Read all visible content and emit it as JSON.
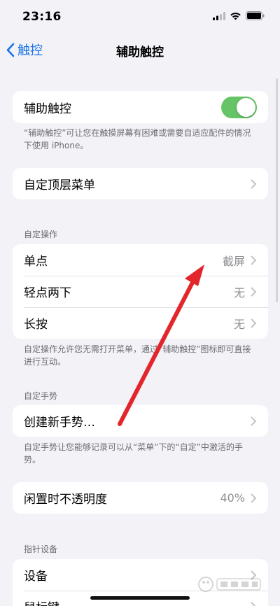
{
  "status": {
    "time": "23:16"
  },
  "nav": {
    "back_label": "触控",
    "title": "辅助触控"
  },
  "main_toggle": {
    "label": "辅助触控",
    "enabled": true,
    "footer": "“辅助触控”可让您在触摸屏幕有困难或需要自适应配件的情况下使用 iPhone。"
  },
  "top_menu": {
    "label": "自定顶层菜单"
  },
  "custom_actions": {
    "header": "自定操作",
    "items": [
      {
        "label": "单点",
        "value": "截屏"
      },
      {
        "label": "轻点两下",
        "value": "无"
      },
      {
        "label": "长按",
        "value": "无"
      }
    ],
    "footer": "自定操作允许您无需打开菜单，通过“辅助触控”图标即可直接进行互动。"
  },
  "custom_gestures": {
    "header": "自定手势",
    "create_label": "创建新手势…",
    "footer": "自定手势让您能够记录可以从“菜单”下的“自定”中激活的手势。"
  },
  "idle_opacity": {
    "label": "闲置时不透明度",
    "value": "40%"
  },
  "pointer_devices": {
    "header": "指针设备",
    "items": [
      {
        "label": "设备"
      },
      {
        "label": "鼠标键"
      }
    ]
  },
  "colors": {
    "accent": "#1a73e8",
    "toggle_on": "#65c466",
    "annotation_arrow": "#e3262b"
  }
}
